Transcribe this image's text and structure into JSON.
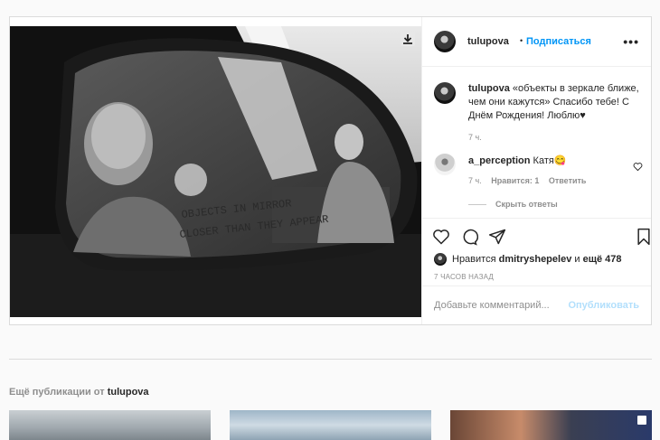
{
  "post": {
    "author": "tulupova",
    "follow_sep": "•",
    "follow_label": "Подписаться",
    "more_glyph": "•••",
    "mirror_text_1": "OBJECTS IN MIRROR",
    "mirror_text_2": "CLOSER THAN THEY APPEAR",
    "caption": {
      "username": "tulupova",
      "text": "«объекты в зеркале ближе, чем они кажутся» Спасибо тебе! С Днём Рождения! Люблю♥",
      "time": "7 ч."
    },
    "comment": {
      "username": "a_perception",
      "text": "Катя😋",
      "time": "7 ч.",
      "likes": "Нравится: 1",
      "reply": "Ответить"
    },
    "hide_replies": "Скрыть ответы",
    "likes": {
      "prefix": "Нравится",
      "user": "dmitryshepelev",
      "conj": "и",
      "others": "ещё 478"
    },
    "timestamp": "7 ЧАСОВ НАЗАД",
    "comment_placeholder": "Добавьте комментарий...",
    "publish_label": "Опубликовать"
  },
  "more_posts": {
    "prefix": "Ещё публикации от",
    "user": "tulupova"
  },
  "icons": [
    "download-icon",
    "more-icon",
    "heart-icon",
    "comment-icon",
    "share-icon",
    "bookmark-icon",
    "like-comment-icon",
    "multi-photo-icon"
  ]
}
